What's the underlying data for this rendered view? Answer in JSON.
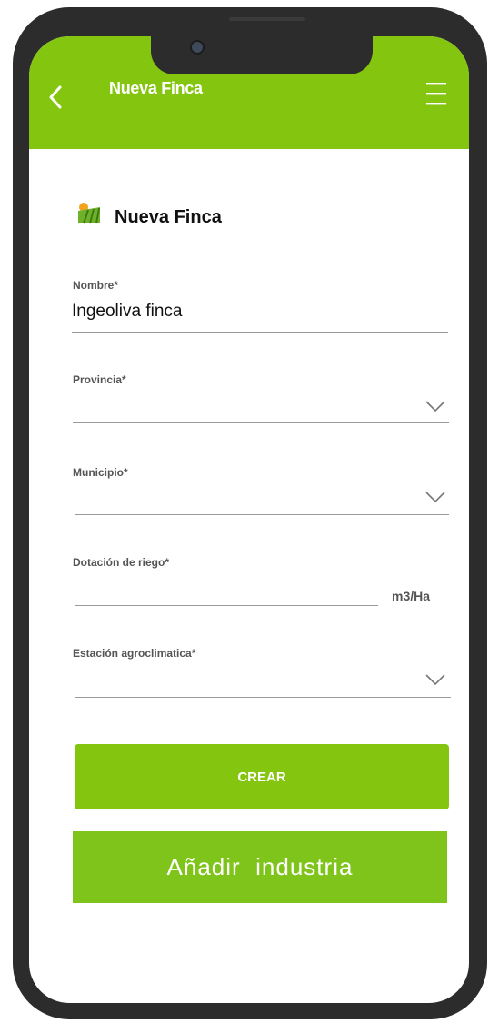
{
  "appbar": {
    "title": "Nueva Finca",
    "back_icon": "chevron-left-icon",
    "menu_icon": "hamburger-menu-icon"
  },
  "card": {
    "title": "Nueva Finca",
    "icon": "farm-field-icon"
  },
  "form": {
    "nombre": {
      "label": "Nombre*",
      "value": "Ingeoliva finca"
    },
    "provincia": {
      "label": "Provincia*",
      "value": ""
    },
    "municipio": {
      "label": "Municipio*",
      "value": ""
    },
    "dotacion": {
      "label": "Dotación de riego*",
      "value": "",
      "unit": "m3/Ha"
    },
    "estacion": {
      "label": "Estación agroclimatica*",
      "value": ""
    }
  },
  "buttons": {
    "crear": "CREAR",
    "anadir_industria": "Añadir  industria"
  },
  "colors": {
    "accent": "#84c510",
    "text": "#111111",
    "label": "#555555",
    "frame": "#2c2c2c"
  }
}
